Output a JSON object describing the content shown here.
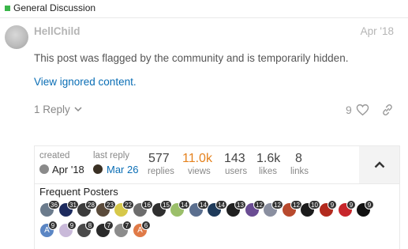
{
  "category": {
    "name": "General Discussion",
    "color": "#3ab54a"
  },
  "post": {
    "username": "HellChild",
    "date": "Apr '18",
    "hidden_message": "This post was flagged by the community and is temporarily hidden.",
    "ignored_link": "View ignored content.",
    "reply_label": "1 Reply",
    "like_count": "9"
  },
  "summary": {
    "created_label": "created",
    "created_date": "Apr '18",
    "last_reply_label": "last reply",
    "last_reply_date": "Mar 26",
    "stats": [
      {
        "value": "577",
        "label": "replies",
        "color": "#444444"
      },
      {
        "value": "11.0k",
        "label": "views",
        "color": "#e5821e"
      },
      {
        "value": "143",
        "label": "users",
        "color": "#444444"
      },
      {
        "value": "1.6k",
        "label": "likes",
        "color": "#444444"
      },
      {
        "value": "8",
        "label": "links",
        "color": "#444444"
      }
    ],
    "posters_title": "Frequent Posters",
    "posters": [
      {
        "count": "36",
        "color": "#6b7b8c"
      },
      {
        "count": "31",
        "color": "#1d2b5e"
      },
      {
        "count": "28",
        "color": "#3b3b3b"
      },
      {
        "count": "23",
        "color": "#5a4a3a"
      },
      {
        "count": "22",
        "color": "#d6c84a"
      },
      {
        "count": "16",
        "color": "#6d6d6d"
      },
      {
        "count": "15",
        "color": "#2f2f2f"
      },
      {
        "count": "14",
        "color": "#9bbf6a"
      },
      {
        "count": "14",
        "color": "#5b6f8f"
      },
      {
        "count": "14",
        "color": "#1e3a5a"
      },
      {
        "count": "13",
        "color": "#202020"
      },
      {
        "count": "12",
        "color": "#6a4c93"
      },
      {
        "count": "12",
        "color": "#8a8fa0"
      },
      {
        "count": "12",
        "color": "#b84a2e"
      },
      {
        "count": "10",
        "color": "#1b1b1b"
      },
      {
        "count": "9",
        "color": "#b22a1e"
      },
      {
        "count": "9",
        "color": "#c7262b"
      },
      {
        "count": "9",
        "color": "#111111"
      },
      {
        "count": "9",
        "color": "#5b86c4",
        "letter": "A"
      },
      {
        "count": "9",
        "color": "#c9b9d9"
      },
      {
        "count": "8",
        "color": "#4a4a4a"
      },
      {
        "count": "7",
        "color": "#2a2a2a"
      },
      {
        "count": "7",
        "color": "#8c8c8c"
      },
      {
        "count": "6",
        "color": "#e07a47",
        "letter": "A"
      }
    ]
  }
}
